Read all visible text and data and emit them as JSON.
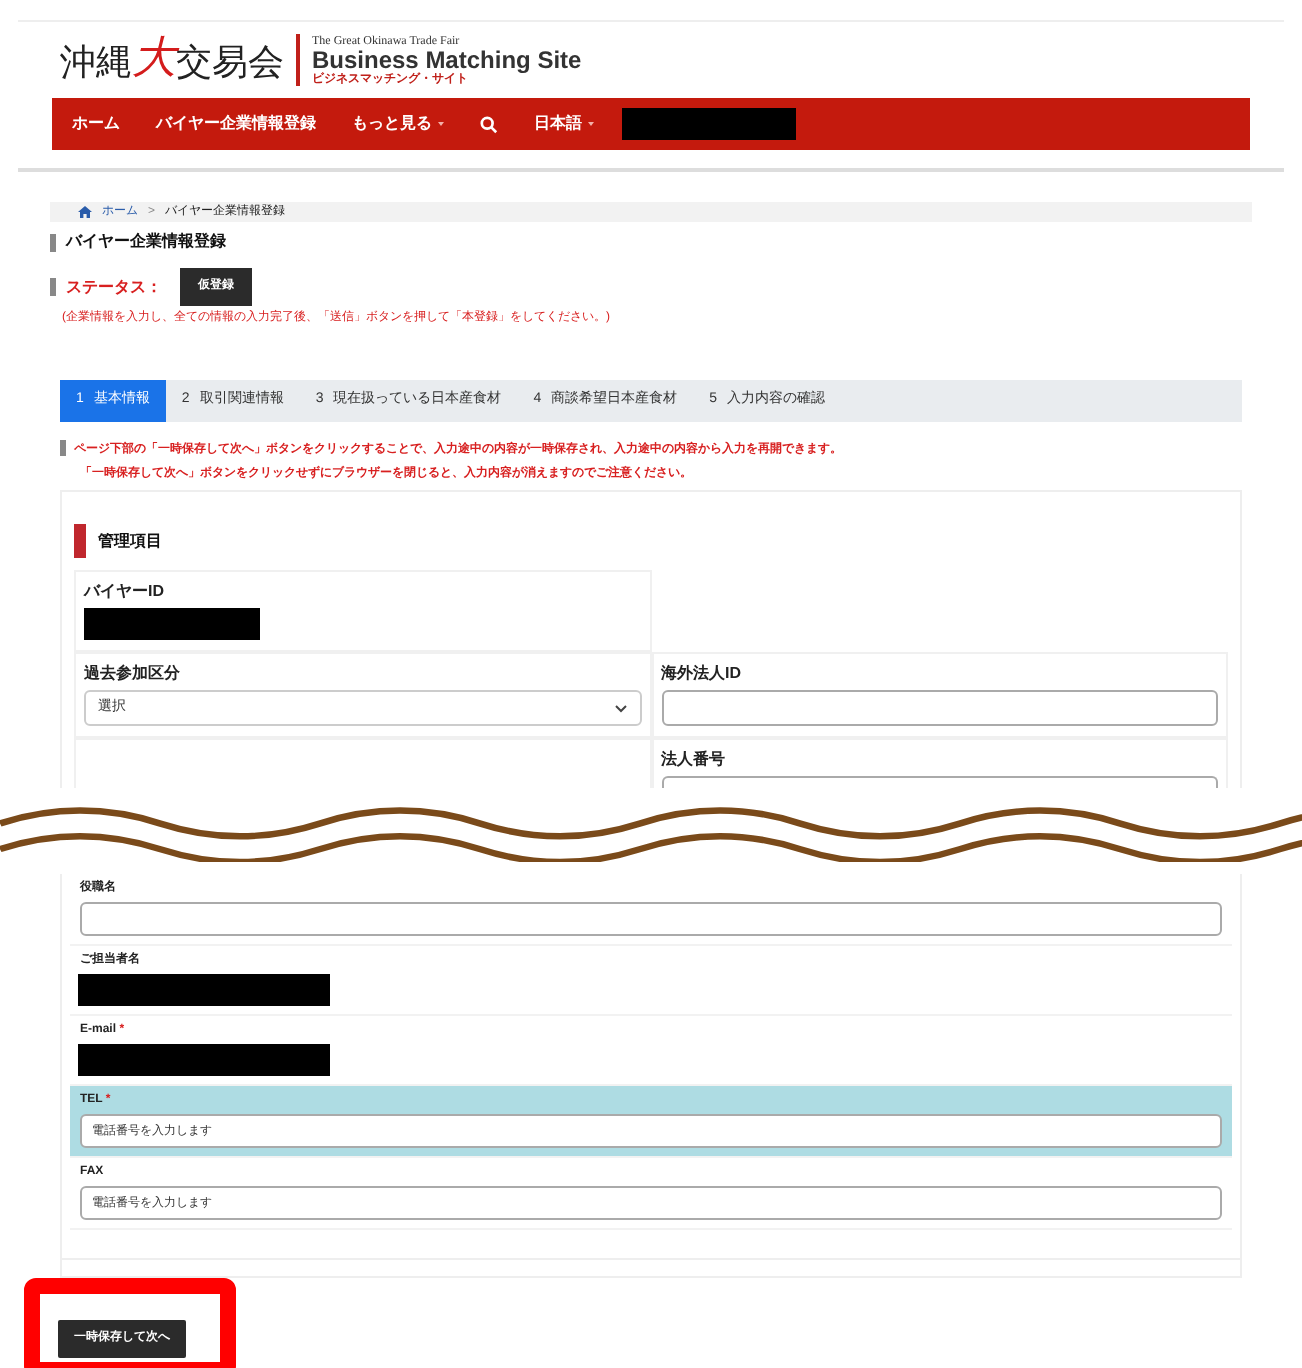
{
  "header": {
    "logo": [
      {
        "text": "沖縄",
        "accent": false
      },
      {
        "text": "大",
        "accent": true
      },
      {
        "text": "交易会",
        "accent": false
      }
    ],
    "tagline_en": "The Great Okinawa Trade Fair",
    "site_name": "Business Matching Site",
    "site_name_ja": "ビジネスマッチング・サイト"
  },
  "nav": [
    {
      "kind": "link",
      "label": "ホーム"
    },
    {
      "kind": "link",
      "label": "バイヤー企業情報登録"
    },
    {
      "kind": "dropdown",
      "label": "もっと見る"
    },
    {
      "kind": "search"
    },
    {
      "kind": "dropdown",
      "label": "日本語"
    },
    {
      "kind": "redacted"
    }
  ],
  "breadcrumb": [
    "ホーム",
    "バイヤー企業情報登録"
  ],
  "breadcrumb_separator": ">",
  "required_mark": "*",
  "page_title": "バイヤー企業情報登録",
  "status": {
    "label": "ステータス：",
    "badge": "仮登録"
  },
  "note": "(企業情報を入力し、全ての情報の入力完了後、「送信」ボタンを押して「本登録」をしてください。)",
  "steps": [
    {
      "number": "1",
      "label": "基本情報",
      "selected": true
    },
    {
      "number": "2",
      "label": "取引関連情報",
      "selected": false
    },
    {
      "number": "3",
      "label": "現在扱っている日本産食材",
      "selected": false
    },
    {
      "number": "4",
      "label": "商談希望日本産食材",
      "selected": false
    },
    {
      "number": "5",
      "label": "入力内容の確認",
      "selected": false
    }
  ],
  "warnings": [
    "ページ下部の「一時保存して次へ」ボタンをクリックすることで、入力途中の内容が一時保存され、入力途中の内容から入力を再開できます。",
    "「一時保存して次へ」ボタンをクリックせずにブラウザーを閉じると、入力内容が消えますのでご注意ください。"
  ],
  "section_title": "管理項目",
  "top_rows": [
    {
      "left": {
        "label": "バイヤーID",
        "kind": "redacted"
      }
    },
    {
      "left": {
        "label": "過去参加区分",
        "kind": "select",
        "value": "選択"
      },
      "right": {
        "label": "海外法人ID",
        "kind": "text"
      }
    },
    {
      "right": {
        "label": "法人番号",
        "kind": "text"
      }
    }
  ],
  "bottom_fields": [
    {
      "label": "役職名",
      "kind": "text",
      "required": false,
      "highlighted": false
    },
    {
      "label": "ご担当者名",
      "kind": "redacted",
      "required": false,
      "highlighted": false
    },
    {
      "label": "E-mail",
      "kind": "redacted",
      "required": true,
      "highlighted": false
    },
    {
      "label": "TEL",
      "kind": "text",
      "placeholder": "電話番号を入力します",
      "required": true,
      "highlighted": true
    },
    {
      "label": "FAX",
      "kind": "text",
      "placeholder": "電話番号を入力します",
      "required": false,
      "highlighted": false
    }
  ],
  "save_button": "一時保存して次へ"
}
